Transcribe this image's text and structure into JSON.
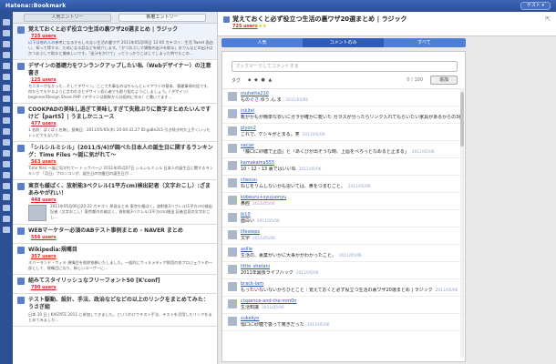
{
  "app": {
    "brand": "Hatena::Bookmark",
    "guest_label": "ゲスト ▾"
  },
  "list_tabs": [
    "人気エントリー",
    "新着エントリー"
  ],
  "entries": [
    {
      "title": "覚えておくと必ず役立つ生活の裏ワザ20選まとめ | ラジック",
      "users": "725 users",
      "snippet": "以下は他の人の参考になるかもしれない生活の裏ワザ 2011年05月06日 12:00 カテゴリ：生活 Tweet 面白い、知って得する、ためになる話などを紹介します。「かつおぶしで鍋物の出汁を取る」おでんなどの出汁はかつおぶしで取ると美味しいです。「出汁をかけて」ってうっかりこぼしてしまった時でもこの…"
    },
    {
      "title": "デザインの基礎力をワンランクアップしたい私（Webデザイナー）の注意書き",
      "users": "125 users",
      "snippet": "モニターがなかった…そしてデザイン。ここで大事なのはちゃんとレイアウトの基本、基礎事項の話です。何からでもやるように言われるとデザイン初心者でも取り組むようにしましょう。/ デザイン/ beginner/Design Share PHP（デザインは根幹から計画的に作る）と書いてます…"
    },
    {
      "title": "COOKPADの美味し過ぎて美味しすぎて失敗ぶりに数字まとめたいんですけど【part5】| うましかニュース",
      "users": "477 users",
      "snippet": "1 名前：ぱくぱく名無し 投稿日：2011/05/05(木) 20:04:31.27 ID:gaBn2L5 引き続き何か上手くいったレシピでもないか…"
    },
    {
      "title": "「シルシルミシル」(2011/5/4)が調べた日本人の誕生日に関するランキング：Time Files 〜誕に気がれて〜",
      "users": "563 users",
      "snippet": "Time files 〜誕に気がれて〜 トップページ 2011年05月07日 シルシルミシル 日本人の誕生日に関するランキング 「月日」ブロンコンが、誕生日の何番目の誕生日が…"
    },
    {
      "title": "東京も緩ばく、放射能3ベクレル(1平方cm)検出記者（文字おこし）:ざまあみやがれい！",
      "users": "448 users",
      "snippet": "2011年05月06日20:22 カテゴリ 原発まとめ 東京も緩ばく。放射能3ベクレル(1平方cm)検出記者（文字おこし）東京都内の被ばく、放射能3ベクレル(1平方cm)検出 記者会見の文字おこし…"
    },
    {
      "title": "WEBマーケター必須のABテスト事例まとめ - NAVER まとめ",
      "users": "556 users",
      "snippet": ""
    },
    {
      "title": "Wikipedia:規嘴目",
      "users": "357 users",
      "snippet": "ネバーランド・ウィキ 規嘴目を削除依頼いたしました。一般的にウィキメディア財団の各プロジェクトの一部として、規嘴目になり、新しいユーザーに…"
    },
    {
      "title": "組みてスタイリッシュなフリーフォント50 [K'conf]",
      "users": "790 users",
      "snippet": ""
    },
    {
      "title": "テスト駆動、設計、手法、政治などなどの以上のリンクをまとめてみた：うさぎ組",
      "users": "",
      "snippet": "日本 10 日 | KAIZATE 2011 に参加してきました。というわけでテスト手法、テストを活用したリンクをまとめてみました…"
    }
  ],
  "detail": {
    "title": "覚えておくと必ず役立つ生活の裏ワザ20選まとめ | ラジック",
    "users": "725 users",
    "stars": "★★★",
    "tabs": [
      "人気",
      "コメントのみ",
      "すべて"
    ],
    "comment_placeholder": "ブックマークしてコメントする",
    "tag_label": "タグ",
    "tag_icons": "▪ ◆ ● ▲",
    "char_count": "0 / 100",
    "add_label": "追加",
    "comments": [
      {
        "user": "muhette210",
        "body": "ものぐさ.ゆう.ん.ま ",
        "date": "2011/05/06"
      },
      {
        "user": "inkltel",
        "body": "靴がかもが簡単な衣いにガラが確かに乾いた  ガラスが分ったらリンク入れてもらいたい家具があるからの3番",
        "date": "2011/05/06"
      },
      {
        "user": "piyon2",
        "body": "これで、ケシキがとまる。笑",
        "date": "2011/05/06"
      },
      {
        "user": "sacjar",
        "body": "「藤口に砂糖で止血」と「あくびが出そうな時、上唇をペろっとなめると止まる」",
        "date": "2011/05/06"
      },
      {
        "user": "kamakama555",
        "body": "10・12・13 裏ではいいね",
        "date": "2011/05/06"
      },
      {
        "user": "chesuu",
        "body": "ねじをリムしないかも思いては、鼻をつまむこと。",
        "date": "2011/05/06"
      },
      {
        "user": "kobeuru+syujuonyu",
        "body": "鼻腔",
        "date": "2011/05/06"
      },
      {
        "user": "lk10",
        "body": "面白い",
        "date": "2011/05/06"
      },
      {
        "user": "lifesteps",
        "body": "文字",
        "date": "2011/05/06"
      },
      {
        "user": "asille",
        "body": "生活の、裏業がいかに大事かがわかったこと。",
        "date": "2011/05/06"
      },
      {
        "user": "little_shetani",
        "body": "2011年最後ライフハック",
        "date": "2011/05/06"
      },
      {
        "user": "brack-lam",
        "body": "もったいないないからひとこと｜覚えておくと必ず役立つ生活の裏ワザ20選まとめ | ラジック",
        "date": "2011/05/06"
      },
      {
        "user": "cixpence-and-the-mm0n",
        "body": "生活知識",
        "date": "2011/05/06"
      },
      {
        "user": "sukekyo",
        "body": "傷口に砂糖で扱って驚きだった",
        "date": "2011/05/06"
      }
    ]
  }
}
